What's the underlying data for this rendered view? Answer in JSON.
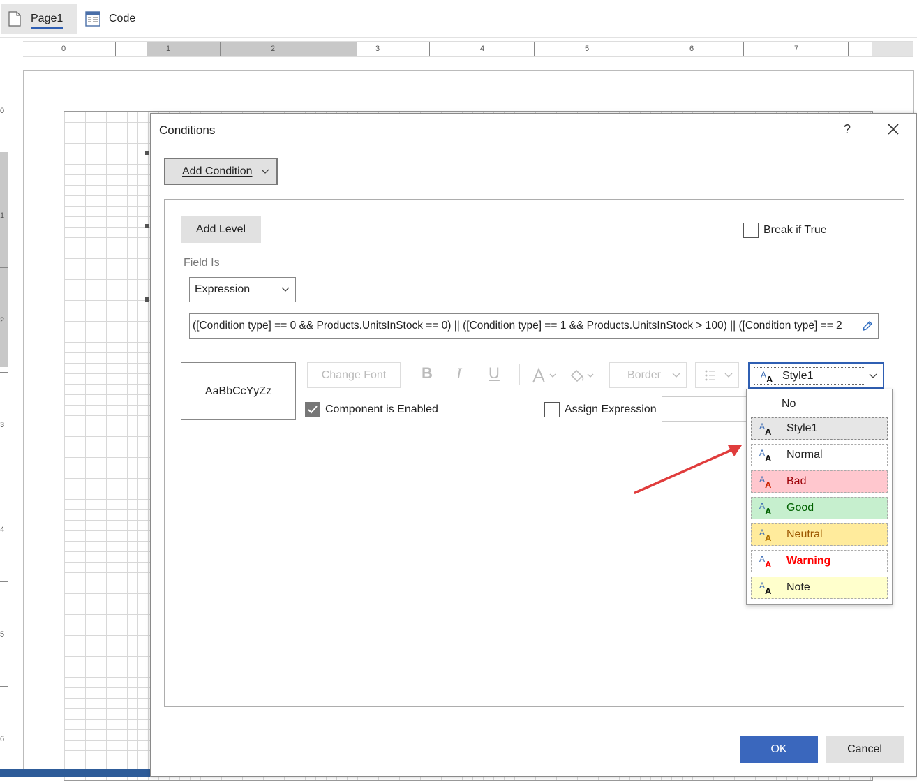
{
  "tabs": [
    {
      "label": "Page1",
      "icon": "page-icon"
    },
    {
      "label": "Code",
      "icon": "code-icon"
    }
  ],
  "ruler": {
    "h_numbers": [
      "0",
      "1",
      "2",
      "3",
      "4",
      "5",
      "6",
      "7"
    ],
    "v_numbers": [
      "0",
      "1",
      "2",
      "3",
      "4",
      "5",
      "6"
    ]
  },
  "dialog": {
    "title": "Conditions",
    "help": "?",
    "add_condition": "Add Condition",
    "add_level": "Add Level",
    "break_if_true": "Break if True",
    "field_is_label": "Field Is",
    "field_is_value": "Expression",
    "expression": "([Condition type] == 0 && Products.UnitsInStock == 0) || ([Condition type] == 1 && Products.UnitsInStock > 100) || ([Condition type] == 2",
    "preview_text": "AaBbCcYyZz",
    "change_font": "Change Font",
    "border_label": "Border",
    "style_value": "Style1",
    "component_enabled": "Component is Enabled",
    "assign_expression": "Assign Expression",
    "ok": "OK",
    "cancel": "Cancel"
  },
  "style_dropdown": {
    "no_label": "No",
    "items": [
      {
        "label": "Style1",
        "bg": "#e6e6e6",
        "color": "#222222",
        "a_color": "#111111"
      },
      {
        "label": "Normal",
        "bg": "#ffffff",
        "color": "#222222",
        "a_color": "#111111"
      },
      {
        "label": "Bad",
        "bg": "#ffc7ce",
        "color": "#9c0006",
        "a_color": "#cc2200"
      },
      {
        "label": "Good",
        "bg": "#c6efce",
        "color": "#006100",
        "a_color": "#006100"
      },
      {
        "label": "Neutral",
        "bg": "#ffeb9c",
        "color": "#9c5700",
        "a_color": "#b07000"
      },
      {
        "label": "Warning",
        "bg": "#ffffff",
        "color": "#ff0000",
        "a_color": "#ff0000"
      },
      {
        "label": "Note",
        "bg": "#ffffcc",
        "color": "#222222",
        "a_color": "#111111"
      }
    ]
  },
  "colors": {
    "accent": "#2f5fb3",
    "ok_button": "#3a67bd",
    "annotation_arrow": "#e03c3c"
  }
}
